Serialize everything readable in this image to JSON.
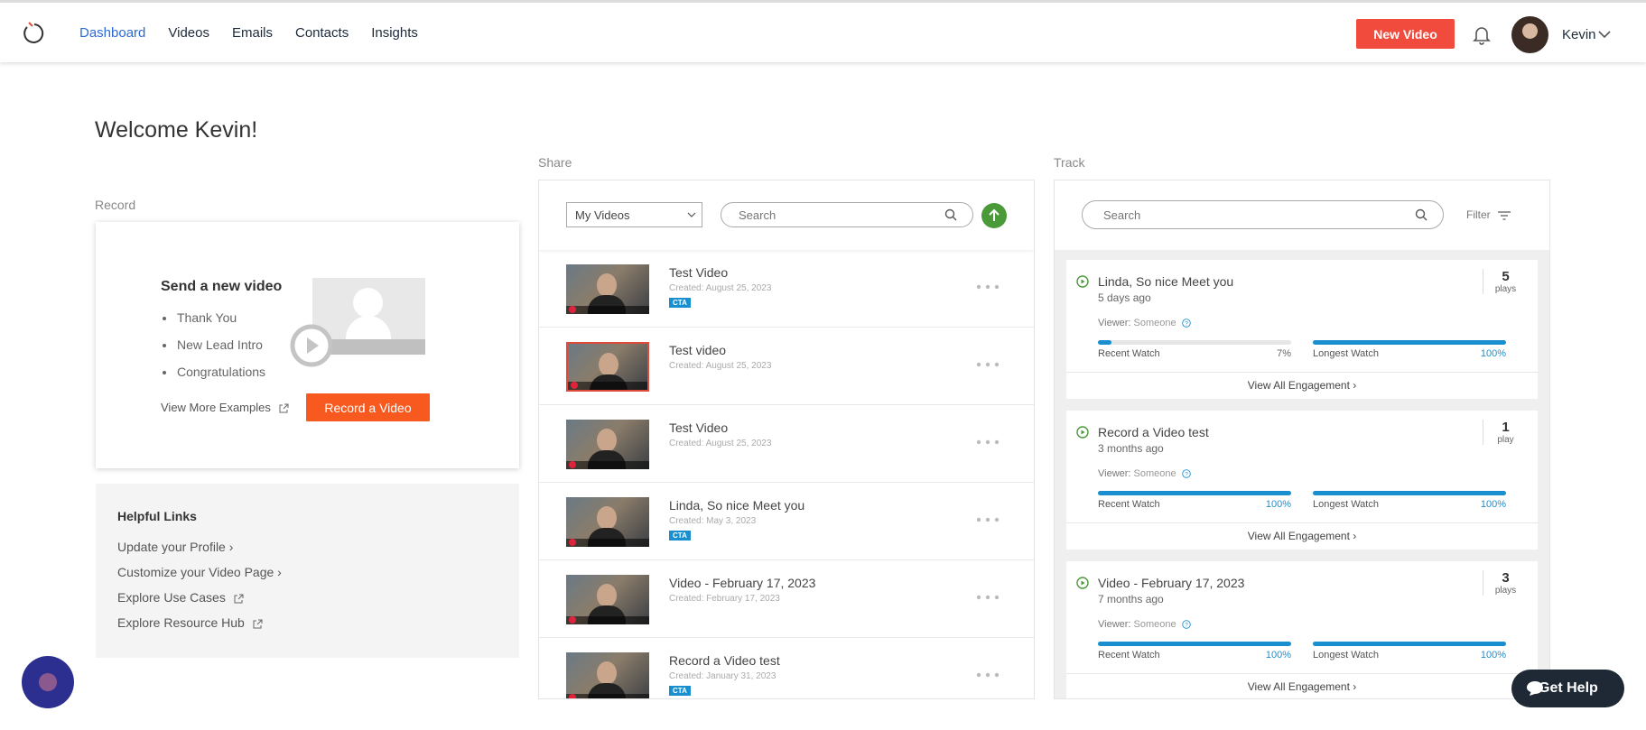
{
  "nav": {
    "items": [
      "Dashboard",
      "Videos",
      "Emails",
      "Contacts",
      "Insights"
    ],
    "new_video": "New Video",
    "user": "Kevin"
  },
  "welcome": "Welcome Kevin!",
  "record": {
    "section": "Record",
    "title": "Send a new video",
    "examples": [
      "Thank You",
      "New Lead Intro",
      "Congratulations"
    ],
    "view_more": "View More Examples",
    "button": "Record a Video"
  },
  "helpful": {
    "title": "Helpful Links",
    "links": [
      "Update your Profile",
      "Customize your Video Page",
      "Explore Use Cases",
      "Explore Resource Hub"
    ]
  },
  "share": {
    "section": "Share",
    "filter_value": "My Videos",
    "search_placeholder": "Search",
    "videos": [
      {
        "title": "Test Video",
        "created": "Created: August 25, 2023",
        "cta": "CTA"
      },
      {
        "title": "Test video",
        "created": "Created: August 25, 2023",
        "cta": ""
      },
      {
        "title": "Test Video",
        "created": "Created: August 25, 2023",
        "cta": ""
      },
      {
        "title": "Linda, So nice Meet you",
        "created": "Created: May 3, 2023",
        "cta": "CTA"
      },
      {
        "title": "Video - February 17, 2023",
        "created": "Created: February 17, 2023",
        "cta": ""
      },
      {
        "title": "Record a Video test",
        "created": "Created: January 31, 2023",
        "cta": "CTA"
      }
    ]
  },
  "track": {
    "section": "Track",
    "search_placeholder": "Search",
    "filter": "Filter",
    "viewer_label": "Viewer:",
    "recent_label": "Recent Watch",
    "longest_label": "Longest Watch",
    "engagement_link": "View All Engagement ›",
    "cards": [
      {
        "title": "Linda, So nice Meet you",
        "ago": "5 days ago",
        "plays": "5",
        "plays_label": "plays",
        "viewer": "Someone",
        "recent": "7%",
        "recent_pct": 7,
        "longest": "100%",
        "longest_pct": 100
      },
      {
        "title": "Record a Video test",
        "ago": "3 months ago",
        "plays": "1",
        "plays_label": "play",
        "viewer": "Someone",
        "recent": "100%",
        "recent_pct": 100,
        "longest": "100%",
        "longest_pct": 100
      },
      {
        "title": "Video - February 17, 2023",
        "ago": "7 months ago",
        "plays": "3",
        "plays_label": "plays",
        "viewer": "Someone",
        "recent": "100%",
        "recent_pct": 100,
        "longest": "100%",
        "longest_pct": 100
      }
    ]
  },
  "help": {
    "label": "Get Help"
  }
}
